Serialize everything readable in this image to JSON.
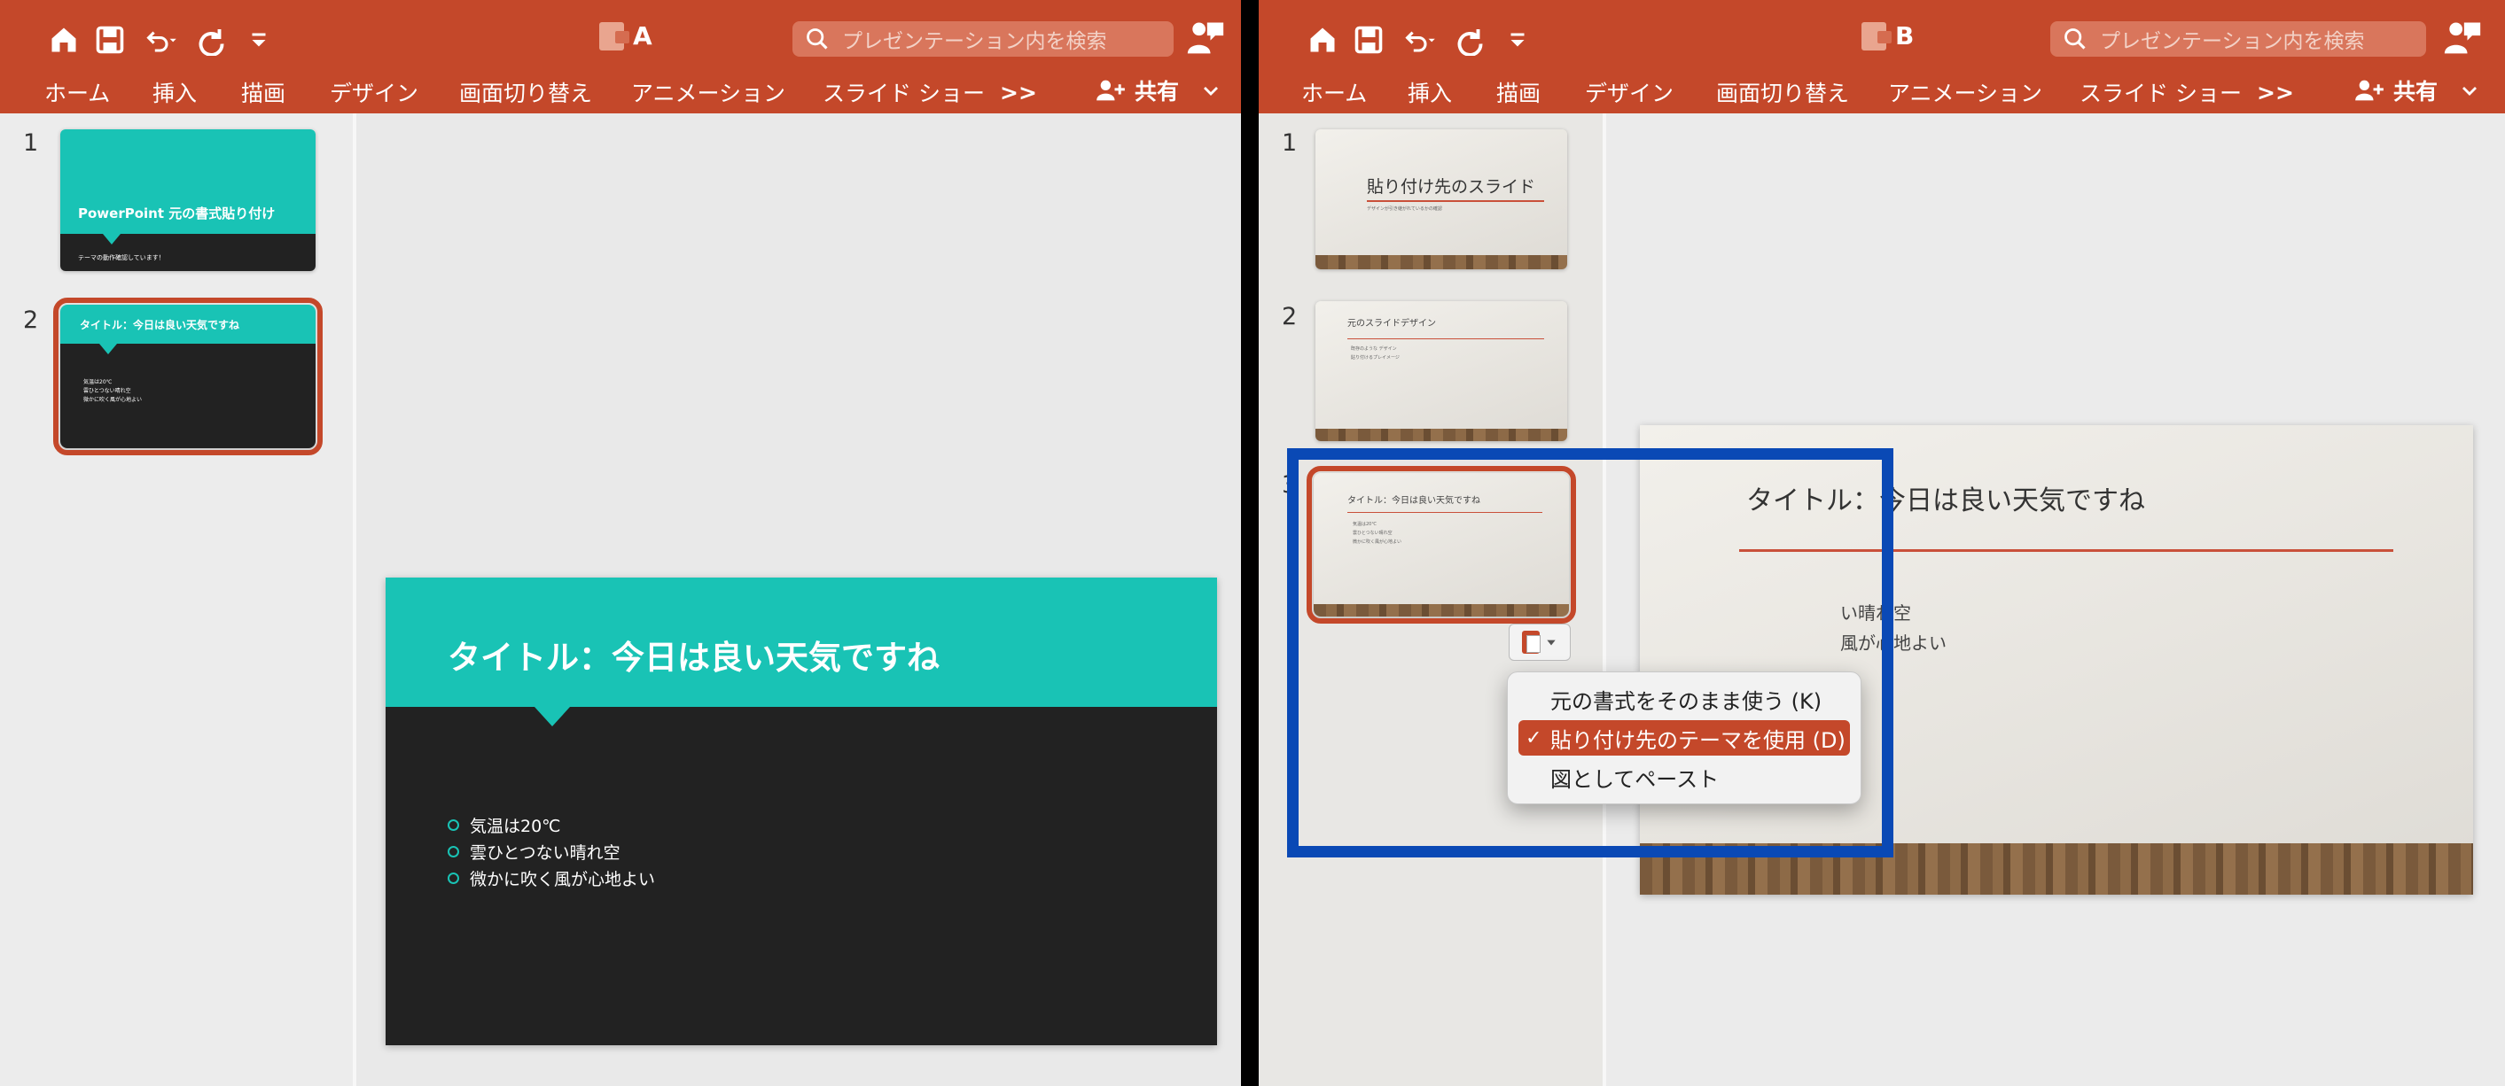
{
  "windowA": {
    "title": "A",
    "search_placeholder": "プレゼンテーション内を検索",
    "tabs": [
      "ホーム",
      "挿入",
      "描画",
      "デザイン",
      "画面切り替え",
      "アニメーション",
      "スライド ショー",
      ">>"
    ],
    "share_label": "共有",
    "slides": [
      {
        "number": "1",
        "title": "PowerPoint 元の書式貼り付け",
        "subtitle": "テーマの動作確認しています！"
      },
      {
        "number": "2",
        "title": "タイトル：今日は良い天気ですね",
        "bullets": [
          "気温は20℃",
          "雲ひとつない晴れ空",
          "微かに吹く風が心地よい"
        ]
      }
    ],
    "main_slide": {
      "title": "タイトル：今日は良い天気ですね",
      "bullets": [
        "気温は20℃",
        "雲ひとつない晴れ空",
        "微かに吹く風が心地よい"
      ]
    }
  },
  "windowB": {
    "title": "B",
    "search_placeholder": "プレゼンテーション内を検索",
    "tabs": [
      "ホーム",
      "挿入",
      "描画",
      "デザイン",
      "画面切り替え",
      "アニメーション",
      "スライド ショー",
      ">>"
    ],
    "share_label": "共有",
    "slides": [
      {
        "number": "1",
        "title": "貼り付け先のスライド",
        "subtitle": "デザインが引き継がれているかの確認"
      },
      {
        "number": "2",
        "title": "元のスライドデザイン",
        "bullets": [
          "既存のような デザイン",
          "貼り付けるプレイメージ"
        ]
      },
      {
        "number": "3",
        "title": "タイトル：今日は良い天気ですね",
        "bullets": [
          "気温は20℃",
          "雲ひとつない晴れ空",
          "微かに吹く風が心地よい"
        ]
      }
    ],
    "main_slide": {
      "title": "タイトル：今日は良い天気ですね",
      "bullets_visible": [
        "い晴れ空",
        "風が心地よい"
      ]
    },
    "paste_menu": {
      "items": [
        "元の書式をそのまま使う (K)",
        "貼り付け先のテーマを使用 (D)",
        "図としてペースト"
      ],
      "selected_index": 1,
      "check": "✓"
    }
  },
  "colors": {
    "ribbon": "#c4482a",
    "teal": "#19c3b5",
    "dark_slide": "#222222",
    "highlight_box": "#0a49b5"
  }
}
